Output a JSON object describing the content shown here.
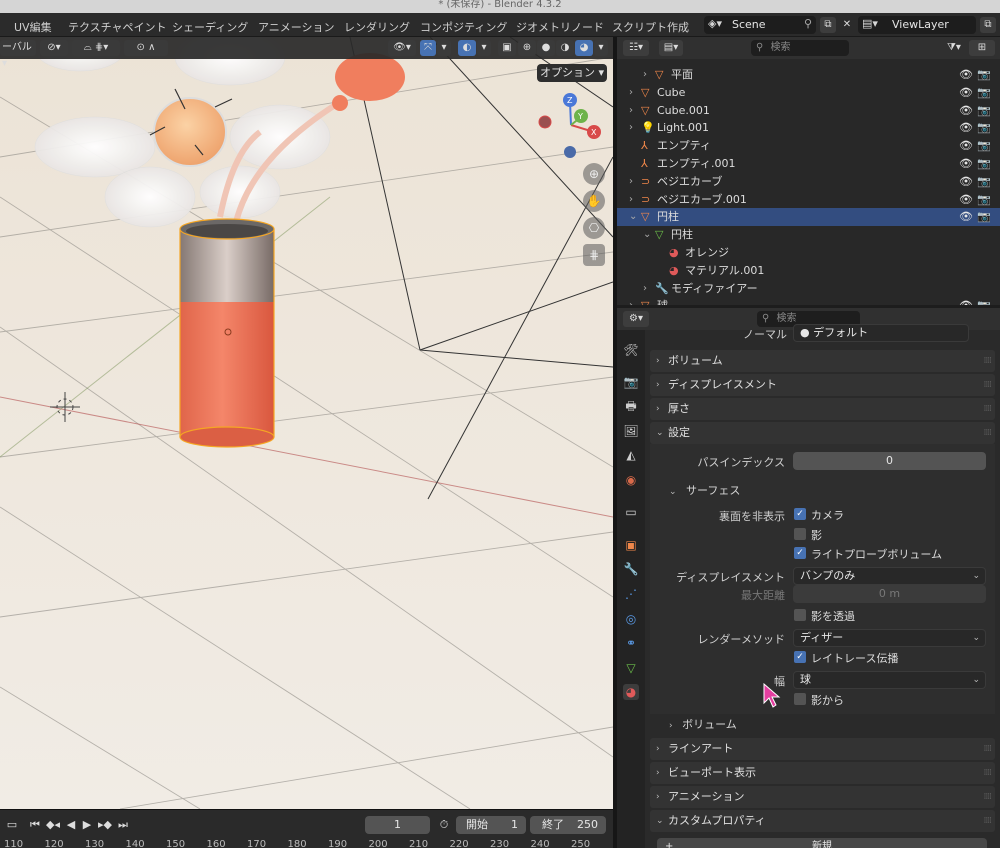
{
  "window": {
    "title": "* (未保存) - Blender 4.3.2"
  },
  "workspaces": [
    "UV編集",
    "テクスチャペイント",
    "シェーディング",
    "アニメーション",
    "レンダリング",
    "コンポジティング",
    "ジオメトリノード",
    "スクリプト作成"
  ],
  "scene": {
    "label": "Scene"
  },
  "view_layer": {
    "label": "ViewLayer"
  },
  "viewport": {
    "header_left_partial": "ーバル",
    "options_label": "オプション"
  },
  "outliner": {
    "search_placeholder": "検索",
    "rows": [
      {
        "label": "平面",
        "icon": "mesh-icon",
        "indent": 2,
        "expand": "right"
      },
      {
        "label": "Cube",
        "icon": "mesh-icon",
        "indent": 1,
        "expand": "right"
      },
      {
        "label": "Cube.001",
        "icon": "mesh-icon",
        "indent": 1,
        "expand": "right"
      },
      {
        "label": "Light.001",
        "icon": "light-icon",
        "indent": 1,
        "expand": "right"
      },
      {
        "label": "エンプティ",
        "icon": "empty-icon",
        "indent": 1,
        "expand": ""
      },
      {
        "label": "エンプティ.001",
        "icon": "empty-icon",
        "indent": 1,
        "expand": ""
      },
      {
        "label": "ベジエカーブ",
        "icon": "curve-icon",
        "indent": 1,
        "expand": "right"
      },
      {
        "label": "ベジエカーブ.001",
        "icon": "curve-icon",
        "indent": 1,
        "expand": "right"
      },
      {
        "label": "円柱",
        "icon": "mesh-icon",
        "indent": 1,
        "expand": "down",
        "selected": true
      },
      {
        "label": "円柱",
        "icon": "mesh-data-icon",
        "indent": 2,
        "expand": "down"
      },
      {
        "label": "オレンジ",
        "icon": "material-icon",
        "indent": 3,
        "expand": ""
      },
      {
        "label": "マテリアル.001",
        "icon": "material-icon",
        "indent": 3,
        "expand": ""
      },
      {
        "label": "モディファイアー",
        "icon": "wrench-icon",
        "indent": 2,
        "expand": "right"
      },
      {
        "label": "球",
        "icon": "mesh-icon",
        "indent": 1,
        "expand": "right"
      }
    ]
  },
  "properties": {
    "search_placeholder": "検索",
    "partial_row": {
      "label": "ノーマル",
      "value": "デフォルト"
    },
    "panels": {
      "volume_top": "ボリューム",
      "displacement": "ディスプレイスメント",
      "thickness": "厚さ",
      "settings": "設定",
      "surface": "サーフェス",
      "volume_sub": "ボリューム",
      "lineart": "ラインアート",
      "viewport_display": "ビューポート表示",
      "animation": "アニメーション",
      "custom_props": "カスタムプロパティ"
    },
    "settings": {
      "pass_index_label": "パスインデックス",
      "pass_index_value": "0",
      "backface_label": "裏面を非表示",
      "camera_label": "カメラ",
      "camera_checked": true,
      "shadow_label": "影",
      "shadow_checked": false,
      "light_probe_label": "ライトプローブボリューム",
      "light_probe_checked": true,
      "displacement_label": "ディスプレイスメント",
      "displacement_value": "バンプのみ",
      "max_distance_label": "最大距離",
      "max_distance_value": "0 m",
      "transparent_shadow_label": "影を透過",
      "transparent_shadow_checked": false,
      "render_method_label": "レンダーメソッド",
      "render_method_value": "ディザー",
      "raytrace_label": "レイトレース伝播",
      "raytrace_checked": true,
      "width_label": "幅",
      "width_value": "球",
      "from_shadow_label": "影から",
      "from_shadow_checked": false
    },
    "new_button": "新規"
  },
  "timeline": {
    "current_frame": "1",
    "start_label": "開始",
    "start_value": "1",
    "end_label": "終了",
    "end_value": "250",
    "ruler": [
      "110",
      "120",
      "130",
      "140",
      "150",
      "160",
      "170",
      "180",
      "190",
      "200",
      "210",
      "220",
      "230",
      "240",
      "250"
    ]
  },
  "colors": {
    "accent": "#4772b3",
    "selection": "#334d80",
    "object_orange": "#f07e5e"
  }
}
